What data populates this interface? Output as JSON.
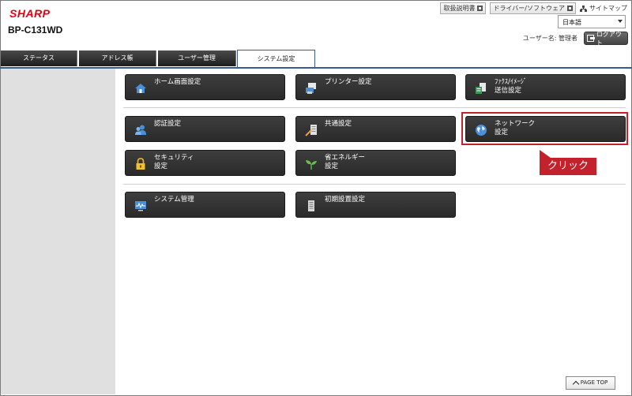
{
  "header": {
    "logo": "SHARP",
    "model": "BP-C131WD",
    "links": {
      "manual": "取扱説明書",
      "driver": "ドライバー/ソフトウェア",
      "sitemap": "サイトマップ"
    },
    "language": "日本語",
    "user_label": "ユーザー名: 管理者",
    "logout_label": "ログアウト"
  },
  "tabs": [
    "ステータス",
    "アドレス帳",
    "ユーザー管理",
    "システム設定"
  ],
  "buttons": {
    "home": "ホーム画面設定",
    "printer": "プリンター設定",
    "fax": "ﾌｧｸｽ/ｲﾒｰｼﾞ\n送信設定",
    "auth": "認証設定",
    "common": "共通設定",
    "network": "ネットワーク\n設定",
    "security": "セキュリティ\n設定",
    "energy": "省エネルギー\n設定",
    "system": "システム管理",
    "initial": "初期設置設定"
  },
  "callout": "クリック",
  "page_top": "PAGE TOP",
  "colors": {
    "accent": "#c3222d",
    "logo": "#e60012",
    "tab_border": "#3d5a8c"
  }
}
